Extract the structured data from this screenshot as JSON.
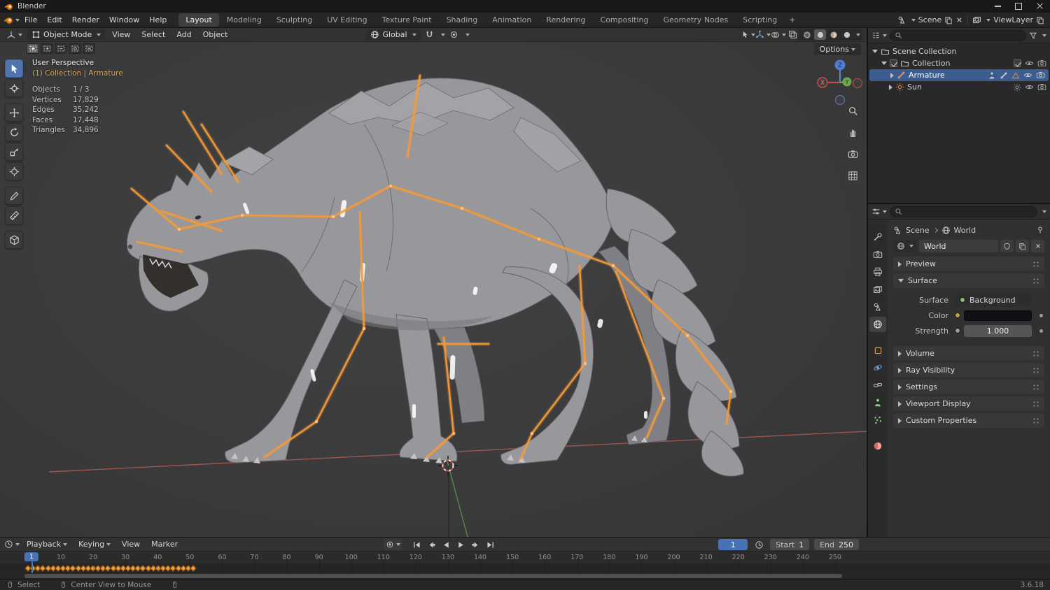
{
  "titlebar": {
    "title": "Blender"
  },
  "topbar": {
    "menus": [
      "File",
      "Edit",
      "Render",
      "Window",
      "Help"
    ],
    "workspaces": [
      "Layout",
      "Modeling",
      "Sculpting",
      "UV Editing",
      "Texture Paint",
      "Shading",
      "Animation",
      "Rendering",
      "Compositing",
      "Geometry Nodes",
      "Scripting"
    ],
    "add_workspace": "+",
    "scene": "Scene",
    "view_layer": "ViewLayer"
  },
  "viewport": {
    "header": {
      "mode": "Object Mode",
      "menus": [
        "View",
        "Select",
        "Add",
        "Object"
      ],
      "orientation": "Global",
      "options": "Options"
    },
    "overlay": {
      "perspective": "User Perspective",
      "context": "(1) Collection | Armature",
      "stats": [
        {
          "label": "Objects",
          "value": "1 / 3"
        },
        {
          "label": "Vertices",
          "value": "17,829"
        },
        {
          "label": "Edges",
          "value": "35,242"
        },
        {
          "label": "Faces",
          "value": "17,448"
        },
        {
          "label": "Triangles",
          "value": "34,896"
        }
      ]
    },
    "gizmo": {
      "x": "X",
      "y": "Y",
      "z": "Z"
    }
  },
  "outliner": {
    "root": "Scene Collection",
    "collection": "Collection",
    "armature": "Armature",
    "sun": "Sun"
  },
  "properties": {
    "breadcrumb_scene": "Scene",
    "breadcrumb_world": "World",
    "datablock": "World",
    "panels": {
      "preview": "Preview",
      "surface": "Surface",
      "volume": "Volume",
      "ray": "Ray Visibility",
      "settings": "Settings",
      "viewport_display": "Viewport Display",
      "custom": "Custom Properties"
    },
    "surface": {
      "label": "Surface",
      "value": "Background",
      "color_label": "Color",
      "strength_label": "Strength",
      "strength_value": "1.000"
    }
  },
  "timeline": {
    "menus": [
      "Playback",
      "Keying",
      "View",
      "Marker"
    ],
    "current_frame": "1",
    "start_label": "Start",
    "start_value": "1",
    "end_label": "End",
    "end_value": "250",
    "playhead": "1",
    "ticks": [
      "10",
      "20",
      "30",
      "40",
      "50",
      "60",
      "70",
      "80",
      "90",
      "100",
      "110",
      "120",
      "130",
      "140",
      "150",
      "160",
      "170",
      "180",
      "190",
      "200",
      "210",
      "220",
      "230",
      "240",
      "250"
    ],
    "keyframe_count": 34
  },
  "statusbar": {
    "select": "Select",
    "center_view": "Center View to Mouse",
    "version": "3.6.18"
  },
  "colors": {
    "accent": "#4772b3",
    "selection_row": "#3c5d8f",
    "keyframe_orange": "#f09b37",
    "bone_orange": "#f49b3a",
    "axis_x": "#b25a5a",
    "axis_y": "#6aa84f"
  }
}
